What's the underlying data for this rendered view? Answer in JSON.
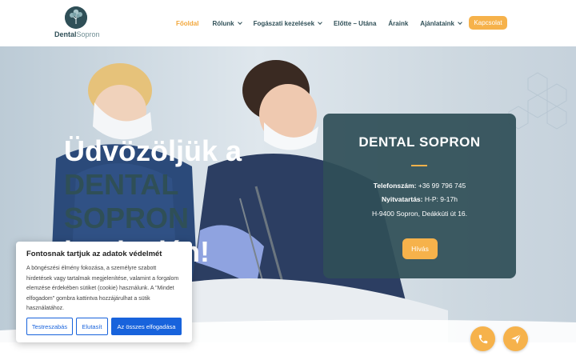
{
  "header": {
    "logo": {
      "brand_bold": "Dental",
      "brand_light": "Sopron"
    },
    "nav": [
      {
        "label": "Főoldal",
        "active": true,
        "dropdown": false
      },
      {
        "label": "Rólunk",
        "active": false,
        "dropdown": true
      },
      {
        "label": "Fogászati kezelések",
        "active": false,
        "dropdown": true
      },
      {
        "label": "Előtte – Utána",
        "active": false,
        "dropdown": false
      },
      {
        "label": "Áraink",
        "active": false,
        "dropdown": false
      },
      {
        "label": "Ajánlataink",
        "active": false,
        "dropdown": true
      }
    ],
    "language_icon": "hungarian-flag-icon",
    "contact_label": "Kapcsolat"
  },
  "hero": {
    "welcome": "Üdvözöljük a",
    "brand_line1": "DENTAL",
    "brand_line2": "SOPRON",
    "tail": "honlapján!"
  },
  "info_card": {
    "title": "DENTAL SOPRON",
    "phone_label": "Telefonszám:",
    "phone_value": "+36 99 796 745",
    "hours_label": "Nyitvatartás:",
    "hours_value": "H-P: 9-17h",
    "address": "H-9400 Sopron, Deákkúti út 16.",
    "call_label": "Hívás"
  },
  "floating": {
    "phone_icon": "phone-icon",
    "send_icon": "paper-plane-icon"
  },
  "cookie": {
    "title": "Fontosnak tartjuk az adatok védelmét",
    "text": "A böngészési élmény fokozása, a személyre szabott hirdetések vagy tartalmak megjelenítése, valamint a forgalom elemzése érdekében sütiket (cookie) használunk. A \"Mindet elfogadom\" gombra kattintva hozzájárulhat a sütik használatához.",
    "customize_label": "Testreszabás",
    "reject_label": "Elutasít",
    "accept_label": "Az összes elfogadása"
  },
  "colors": {
    "brand_dark": "#2f4f57",
    "accent": "#f6b24b",
    "cookie_blue": "#1863dc"
  }
}
